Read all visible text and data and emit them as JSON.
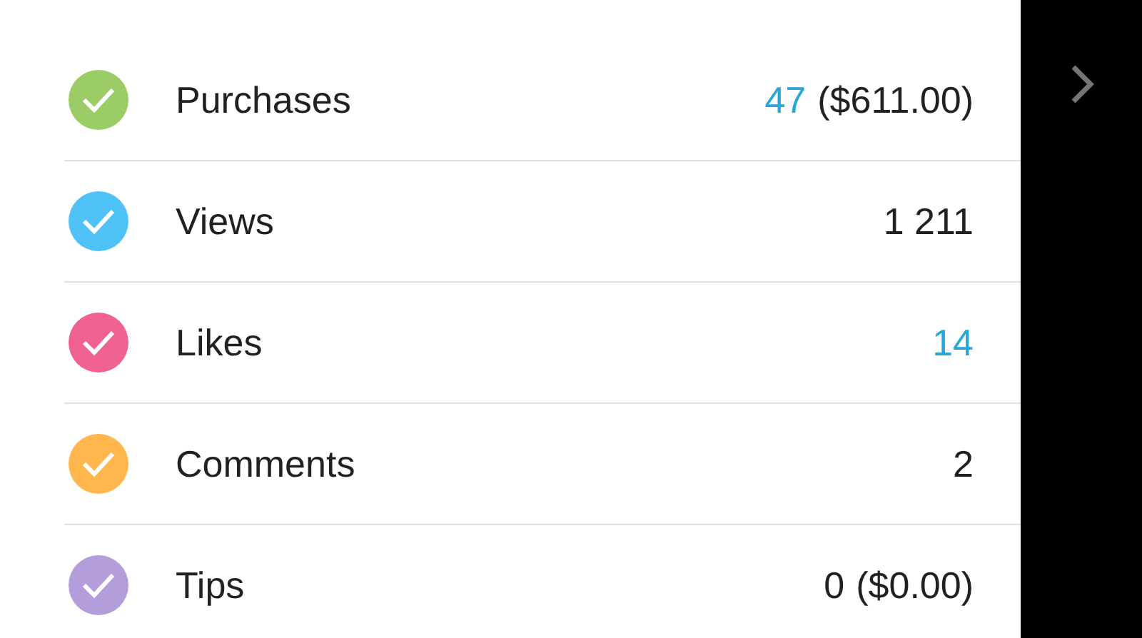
{
  "rows": [
    {
      "label": "Purchases",
      "color": "#9ccc65",
      "count": "47",
      "count_highlighted": true,
      "amount": "($611.00)"
    },
    {
      "label": "Views",
      "color": "#4fc3f7",
      "count": "1 211",
      "count_highlighted": false
    },
    {
      "label": "Likes",
      "color": "#f06292",
      "count": "14",
      "count_highlighted": true
    },
    {
      "label": "Comments",
      "color": "#ffb74d",
      "count": "2",
      "count_highlighted": false
    },
    {
      "label": "Tips",
      "color": "#b39ddb",
      "count": "0",
      "count_highlighted": false,
      "amount": "($0.00)"
    }
  ]
}
